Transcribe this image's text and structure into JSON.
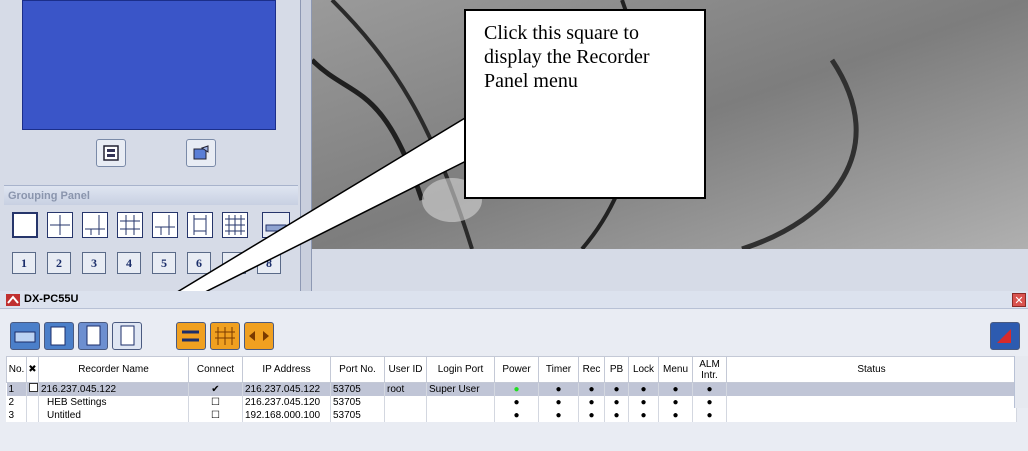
{
  "callout": {
    "text": "Click this square to display the Recorder Panel menu"
  },
  "grouping_panel": {
    "title": "Grouping Panel",
    "numbers": [
      "1",
      "2",
      "3",
      "4",
      "5",
      "6",
      "7",
      "8"
    ]
  },
  "recorder_panel": {
    "title": "DX-PC55U",
    "close_glyph": "✕",
    "columns": [
      "No.",
      "",
      "Recorder Name",
      "Connect",
      "IP Address",
      "Port No.",
      "User ID",
      "Login Port",
      "Power",
      "Timer",
      "Rec",
      "PB",
      "Lock",
      "Menu",
      "ALM Intr.",
      "Status"
    ],
    "rows": [
      {
        "no": "1",
        "name": "216.237.045.122",
        "connect": "✔",
        "ip": "216.237.045.122",
        "port": "53705",
        "user": "root",
        "login": "Super User",
        "power": "●",
        "timer": "●",
        "rec": "●",
        "pb": "●",
        "lock": "●",
        "menu": "●",
        "alm": "●",
        "status": ""
      },
      {
        "no": "2",
        "name": "HEB Settings",
        "connect": "☐",
        "ip": "216.237.045.120",
        "port": "53705",
        "user": "",
        "login": "",
        "power": "●",
        "timer": "●",
        "rec": "●",
        "pb": "●",
        "lock": "●",
        "menu": "●",
        "alm": "●",
        "status": ""
      },
      {
        "no": "3",
        "name": "Untitled",
        "connect": "☐",
        "ip": "192.168.000.100",
        "port": "53705",
        "user": "",
        "login": "",
        "power": "●",
        "timer": "●",
        "rec": "●",
        "pb": "●",
        "lock": "●",
        "menu": "●",
        "alm": "●",
        "status": ""
      }
    ]
  },
  "colors": {
    "power_on": "#22dd22",
    "dot": "#000000",
    "selected_row": "#c0c5d6"
  }
}
